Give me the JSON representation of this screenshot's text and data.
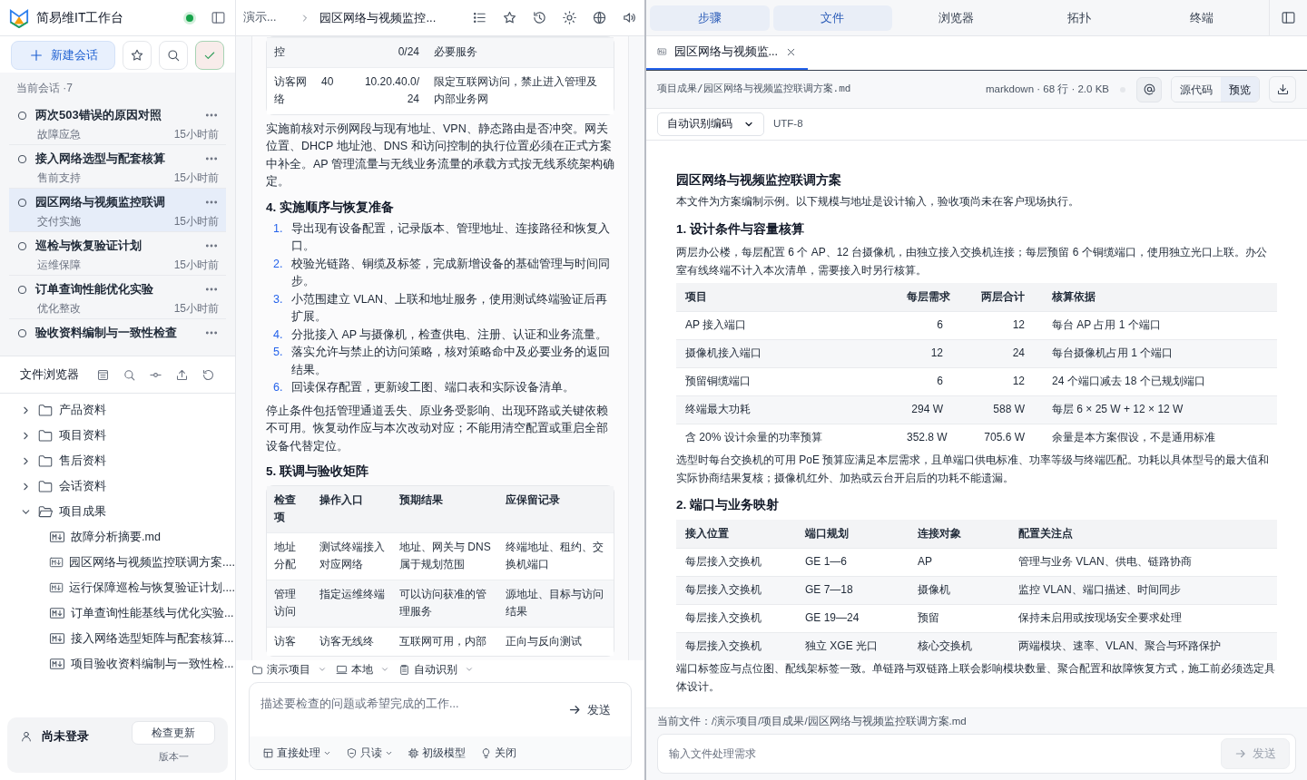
{
  "app": {
    "title": "简易维IT工作台",
    "online": true
  },
  "sidebar": {
    "new_button": "新建会话",
    "section_label": "当前会话 ·7",
    "sessions": [
      {
        "title": "两次503错误的原因对照",
        "category": "故障应急",
        "time": "15小时前",
        "selected": false
      },
      {
        "title": "接入网络选型与配套核算",
        "category": "售前支持",
        "time": "15小时前",
        "selected": false
      },
      {
        "title": "园区网络与视频监控联调",
        "category": "交付实施",
        "time": "15小时前",
        "selected": true
      },
      {
        "title": "巡检与恢复验证计划",
        "category": "运维保障",
        "time": "15小时前",
        "selected": false
      },
      {
        "title": "订单查询性能优化实验",
        "category": "优化整改",
        "time": "15小时前",
        "selected": false
      },
      {
        "title": "验收资料编制与一致性检查",
        "selected": false
      }
    ]
  },
  "file_browser": {
    "title": "文件浏览器",
    "tree": [
      {
        "name": "产品资料",
        "kind": "folder",
        "expanded": false
      },
      {
        "name": "项目资料",
        "kind": "folder",
        "expanded": false
      },
      {
        "name": "售后资料",
        "kind": "folder",
        "expanded": false
      },
      {
        "name": "会话资料",
        "kind": "folder",
        "expanded": false
      },
      {
        "name": "项目成果",
        "kind": "folder",
        "expanded": true,
        "children": [
          {
            "name": "故障分析摘要.md",
            "kind": "file"
          },
          {
            "name": "园区网络与视频监控联调方案....",
            "kind": "file"
          },
          {
            "name": "运行保障巡检与恢复验证计划....",
            "kind": "file"
          },
          {
            "name": "订单查询性能基线与优化实验...",
            "kind": "file"
          },
          {
            "name": "接入网络选型矩阵与配套核算...",
            "kind": "file"
          },
          {
            "name": "项目验收资料编制与一致性检...",
            "kind": "file"
          }
        ]
      }
    ]
  },
  "user": {
    "name": "尚未登录",
    "update_button": "检查更新",
    "version": "版本一"
  },
  "conversation": {
    "breadcrumb": [
      "演示...",
      "园区网络与视频监控..."
    ],
    "blocks": [
      {
        "kind": "table",
        "rows": [
          [
            "控",
            "",
            "0/24",
            "必要服务"
          ],
          [
            "访客网络",
            "40",
            "10.20.40.0/24",
            "限定互联网访问，禁止进入管理及内部业务网"
          ]
        ]
      },
      {
        "kind": "paragraph",
        "text": "实施前核对示例网段与现有地址、VPN、静态路由是否冲突。网关位置、DHCP 地址池、DNS 和访问控制的执行位置必须在正式方案中补全。AP 管理流量与无线业务流量的承载方式按无线系统架构确定。"
      },
      {
        "kind": "heading",
        "text": "4. 实施顺序与恢复准备"
      },
      {
        "kind": "list",
        "items": [
          {
            "number": "1.",
            "text": "导出现有设备配置，记录版本、管理地址、连接路径和恢复入口。"
          },
          {
            "number": "2.",
            "text": "校验光链路、铜缆及标签，完成新增设备的基础管理与时间同步。"
          },
          {
            "number": "3.",
            "text": "小范围建立 VLAN、上联和地址服务，使用测试终端验证后再扩展。"
          },
          {
            "number": "4.",
            "text": "分批接入 AP 与摄像机，检查供电、注册、认证和业务流量。"
          },
          {
            "number": "5.",
            "text": "落实允许与禁止的访问策略，核对策略命中及必要业务的返回结果。"
          },
          {
            "number": "6.",
            "text": "回读保存配置，更新竣工图、端口表和实际设备清单。"
          }
        ]
      },
      {
        "kind": "paragraph",
        "text": "停止条件包括管理通道丢失、原业务受影响、出现环路或关键依赖不可用。恢复动作应与本次改动对应；不能用清空配置或重启全部设备代替定位。"
      },
      {
        "kind": "heading",
        "text": "5. 联调与验收矩阵"
      },
      {
        "kind": "table",
        "columns": [
          "检查项",
          "操作入口",
          "预期结果",
          "应保留记录"
        ],
        "rows": [
          [
            "地址分配",
            "测试终端接入对应网络",
            "地址、网关与 DNS 属于规划范围",
            "终端地址、租约、交换机端口"
          ],
          [
            "管理访问",
            "指定运维终端",
            "可以访问获准的管理服务",
            "源地址、目标与访问结果"
          ],
          [
            "访客",
            "访客无线终",
            "互联网可用，内部",
            "正向与反向测试"
          ]
        ]
      }
    ]
  },
  "composer": {
    "selectors": [
      "演示项目",
      "本地",
      "自动识别"
    ],
    "placeholder": "描述要检查的问题或希望完成的工作...",
    "send": "发送",
    "options": [
      {
        "label": "直接处理",
        "has_menu": true
      },
      {
        "label": "只读",
        "has_menu": true
      },
      {
        "label": "初级模型",
        "has_menu": false
      },
      {
        "label": "关闭",
        "has_menu": false
      }
    ]
  },
  "right_panel": {
    "tabs": [
      {
        "label": "步骤",
        "selected": true
      },
      {
        "label": "文件",
        "selected": true
      },
      {
        "label": "浏览器",
        "selected": false
      },
      {
        "label": "拓扑",
        "selected": false
      },
      {
        "label": "终端",
        "selected": false
      }
    ],
    "file_tab": {
      "label": "园区网络与视频监...",
      "selected": true
    },
    "path": "项目成果/园区网络与视频监控联调方案.md",
    "meta": "markdown · 68 行 · 2.0 KB",
    "view_modes": [
      {
        "label": "源代码",
        "selected": false
      },
      {
        "label": "预览",
        "selected": true
      }
    ],
    "encoding": "自动识别编码",
    "detected_encoding": "UTF-8",
    "blocks": [
      {
        "kind": "title",
        "text": "园区网络与视频监控联调方案"
      },
      {
        "kind": "paragraph",
        "text": "本文件为方案编制示例。以下规模与地址是设计输入，验收项尚未在客户现场执行。"
      },
      {
        "kind": "heading",
        "text": "1. 设计条件与容量核算"
      },
      {
        "kind": "paragraph",
        "text": "两层办公楼，每层配置 6 个 AP、12 台摄像机，由独立接入交换机连接；每层预留 6 个铜缆端口，使用独立光口上联。办公室有线终端不计入本次清单，需要接入时另行核算。"
      },
      {
        "kind": "table",
        "columns": [
          "项目",
          "每层需求",
          "两层合计",
          "核算依据"
        ],
        "rows": [
          [
            "AP 接入端口",
            "6",
            "12",
            "每台 AP 占用 1 个端口"
          ],
          [
            "摄像机接入端口",
            "12",
            "24",
            "每台摄像机占用 1 个端口"
          ],
          [
            "预留铜缆端口",
            "6",
            "12",
            "24 个端口减去 18 个已规划端口"
          ],
          [
            "终端最大功耗",
            "294 W",
            "588 W",
            "每层 6 × 25 W + 12 × 12 W"
          ],
          [
            "含 20% 设计余量的功率预算",
            "352.8 W",
            "705.6 W",
            "余量是本方案假设，不是通用标准"
          ]
        ]
      },
      {
        "kind": "paragraph",
        "text": "选型时每台交换机的可用 PoE 预算应满足本层需求，且单端口供电标准、功率等级与终端匹配。功耗以具体型号的最大值和实际协商结果复核；摄像机红外、加热或云台开启后的功耗不能遗漏。"
      },
      {
        "kind": "heading",
        "text": "2. 端口与业务映射"
      },
      {
        "kind": "table",
        "columns": [
          "接入位置",
          "端口规划",
          "连接对象",
          "配置关注点"
        ],
        "rows": [
          [
            "每层接入交换机",
            "GE 1—6",
            "AP",
            "管理与业务 VLAN、供电、链路协商"
          ],
          [
            "每层接入交换机",
            "GE 7—18",
            "摄像机",
            "监控 VLAN、端口描述、时间同步"
          ],
          [
            "每层接入交换机",
            "GE 19—24",
            "预留",
            "保持未启用或按现场安全要求处理"
          ],
          [
            "每层接入交换机",
            "独立 XGE 光口",
            "核心交换机",
            "两端模块、速率、VLAN、聚合与环路保护"
          ]
        ]
      },
      {
        "kind": "paragraph",
        "text": "端口标签应与点位图、配线架标签一致。单链路与双链路上联会影响模块数量、聚合配置和故障恢复方式，施工前必须选定具体设计。"
      }
    ],
    "current_file": "当前文件：/演示项目/项目成果/园区网络与视频监控联调方案.md",
    "input_placeholder": "输入文件处理需求",
    "send": "发送",
    "send_disabled": true
  }
}
